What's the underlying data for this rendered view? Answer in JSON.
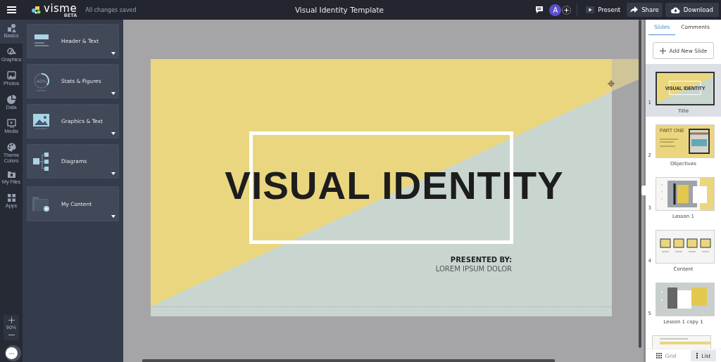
{
  "topbar": {
    "logo": "visme",
    "logo_badge": "BETA",
    "save_status": "All changes saved",
    "title": "Visual Identity Template",
    "avatar": "A",
    "buttons": [
      {
        "label": "Present",
        "kind": "present"
      },
      {
        "label": "Share",
        "kind": "share"
      },
      {
        "label": "Download",
        "kind": "download"
      }
    ]
  },
  "rail": {
    "items": [
      {
        "label": "Basics",
        "kind": "basics",
        "selected": true
      },
      {
        "label": "Graphics",
        "kind": "graphics",
        "selected": false
      },
      {
        "label": "Photos",
        "kind": "photos",
        "selected": false
      },
      {
        "label": "Data",
        "kind": "data",
        "selected": false
      },
      {
        "label": "Media",
        "kind": "media",
        "selected": false
      },
      {
        "label": "Theme Colors",
        "kind": "theme",
        "selected": false
      },
      {
        "label": "My Files",
        "kind": "files",
        "selected": false
      },
      {
        "label": "Apps",
        "kind": "apps",
        "selected": false
      }
    ],
    "zoom": "90%"
  },
  "panel": {
    "cards": [
      {
        "label": "Header & Text",
        "kind": "header"
      },
      {
        "label": "Stats & Figures",
        "kind": "stats",
        "figure": "40%"
      },
      {
        "label": "Graphics & Text",
        "kind": "graphics"
      },
      {
        "label": "Diagrams",
        "kind": "diagram"
      },
      {
        "label": "My Content",
        "kind": "folder"
      }
    ]
  },
  "slide": {
    "title": "VISUAL IDENTITY",
    "presenter_label": "PRESENTED BY:",
    "presenter_name": "LOREM IPSUM DOLOR"
  },
  "slides_panel": {
    "tabs": [
      {
        "label": "Slides",
        "selected": true
      },
      {
        "label": "Comments",
        "selected": false
      }
    ],
    "add_button": "Add New Slide",
    "slides": [
      {
        "number": "1",
        "name": "Title",
        "kind": "title",
        "thumb_text": "VISUAL IDENTITY",
        "selected": true
      },
      {
        "number": "2",
        "name": "Objectives",
        "kind": "part",
        "thumb_text": "PART ONE",
        "selected": false
      },
      {
        "number": "3",
        "name": "Lesson 1",
        "kind": "photo-card",
        "selected": false
      },
      {
        "number": "4",
        "name": "Content",
        "kind": "icons",
        "selected": false
      },
      {
        "number": "5",
        "name": "Lesson 1 copy 1",
        "kind": "photo-gray",
        "selected": false
      },
      {
        "kind": "partial",
        "selected": false
      }
    ],
    "view_buttons": [
      {
        "label": "Grid",
        "kind": "grid",
        "selected": false
      },
      {
        "label": "List",
        "kind": "list",
        "selected": true
      }
    ]
  }
}
